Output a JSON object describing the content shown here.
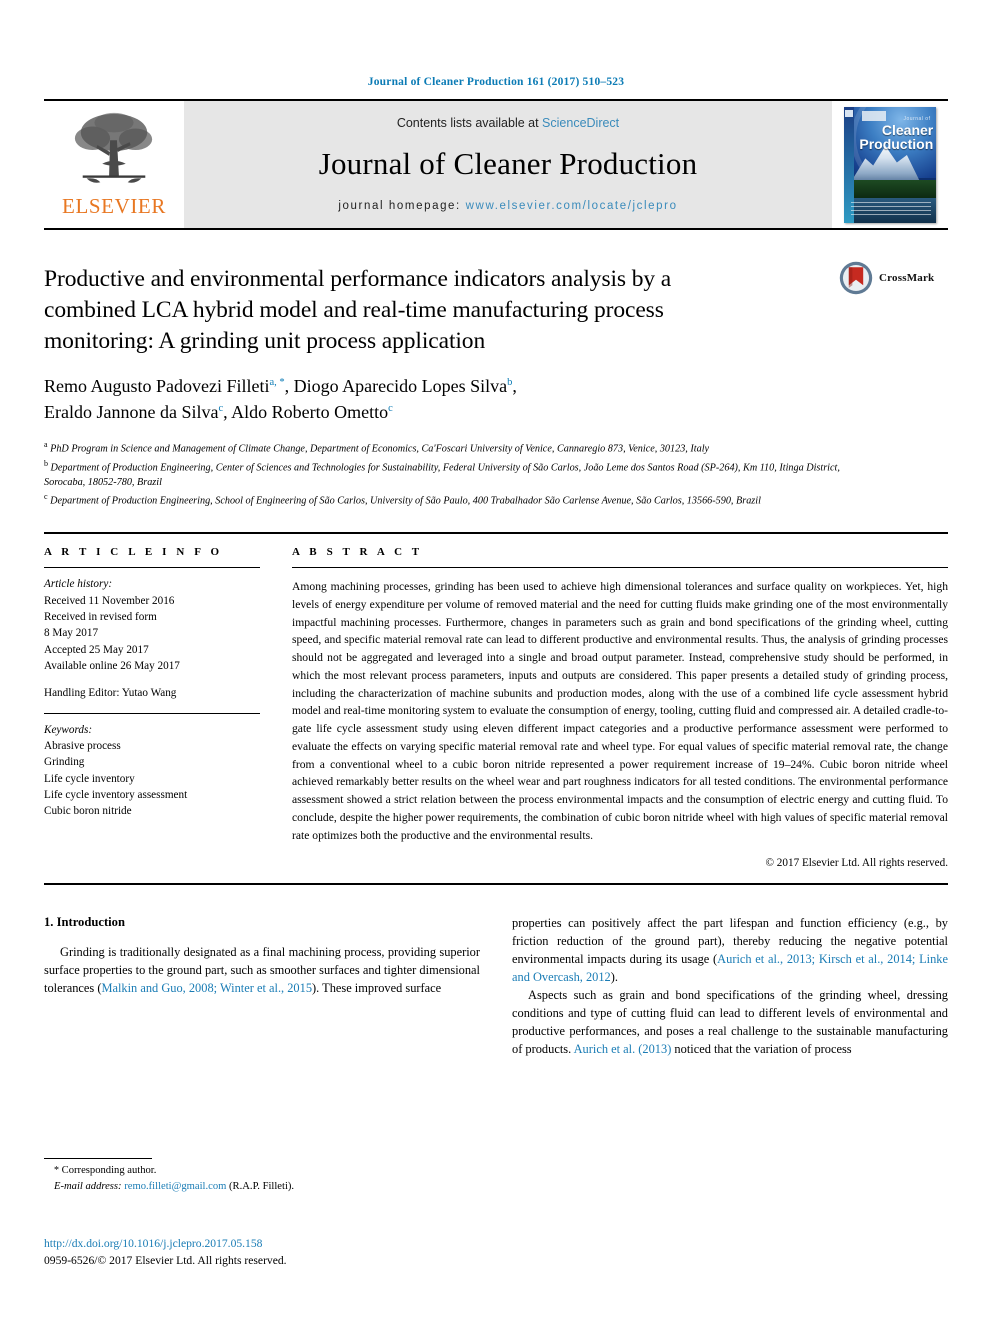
{
  "running_head": "Journal of Cleaner Production 161 (2017) 510–523",
  "masthead": {
    "publisher_name": "ELSEVIER",
    "contents_prefix": "Contents lists available at ",
    "contents_link": "ScienceDirect",
    "journal_name": "Journal of Cleaner Production",
    "homepage_prefix": "journal homepage: ",
    "homepage_url": "www.elsevier.com/locate/jclepro",
    "cover": {
      "small_title": "Journal of",
      "big_title_line1": "Cleaner",
      "big_title_line2": "Production"
    }
  },
  "crossmark": {
    "label": "CrossMark"
  },
  "article": {
    "title": "Productive and environmental performance indicators analysis by a combined LCA hybrid model and real-time manufacturing process monitoring: A grinding unit process application",
    "authors_line1_name1": "Remo Augusto Padovezi Filleti",
    "authors_line1_sup1": "a, *",
    "authors_line1_sep1": ", ",
    "authors_line1_name2": "Diogo Aparecido Lopes Silva",
    "authors_line1_sup2": "b",
    "authors_line1_end": ",",
    "authors_line2_name1": "Eraldo Jannone da Silva",
    "authors_line2_sup1": "c",
    "authors_line2_sep": ", ",
    "authors_line2_name2": "Aldo Roberto Ometto",
    "authors_line2_sup2": "c",
    "affiliations": [
      {
        "marker": "a",
        "text": "PhD Program in Science and Management of Climate Change, Department of Economics, Ca'Foscari University of Venice, Cannaregio 873, Venice, 30123, Italy"
      },
      {
        "marker": "b",
        "text": "Department of Production Engineering, Center of Sciences and Technologies for Sustainability, Federal University of São Carlos, João Leme dos Santos Road (SP-264), Km 110, Itinga District, Sorocaba, 18052-780, Brazil"
      },
      {
        "marker": "c",
        "text": "Department of Production Engineering, School of Engineering of São Carlos, University of São Paulo, 400 Trabalhador São Carlense Avenue, São Carlos, 13566-590, Brazil"
      }
    ]
  },
  "article_info": {
    "heading": "A R T I C L E   I N F O",
    "history_label": "Article history:",
    "received": "Received 11 November 2016",
    "revised_label": "Received in revised form",
    "revised_date": "8 May 2017",
    "accepted": "Accepted 25 May 2017",
    "available": "Available online 26 May 2017",
    "handling_editor": "Handling Editor: Yutao Wang",
    "keywords_label": "Keywords:",
    "keywords": [
      "Abrasive process",
      "Grinding",
      "Life cycle inventory",
      "Life cycle inventory assessment",
      "Cubic boron nitride"
    ]
  },
  "abstract": {
    "heading": "A B S T R A C T",
    "text": "Among machining processes, grinding has been used to achieve high dimensional tolerances and surface quality on workpieces. Yet, high levels of energy expenditure per volume of removed material and the need for cutting fluids make grinding one of the most environmentally impactful machining processes. Furthermore, changes in parameters such as grain and bond specifications of the grinding wheel, cutting speed, and specific material removal rate can lead to different productive and environmental results. Thus, the analysis of grinding processes should not be aggregated and leveraged into a single and broad output parameter. Instead, comprehensive study should be performed, in which the most relevant process parameters, inputs and outputs are considered. This paper presents a detailed study of grinding process, including the characterization of machine subunits and production modes, along with the use of a combined life cycle assessment hybrid model and real-time monitoring system to evaluate the consumption of energy, tooling, cutting fluid and compressed air. A detailed cradle-to-gate life cycle assessment study using eleven different impact categories and a productive performance assessment were performed to evaluate the effects on varying specific material removal rate and wheel type. For equal values of specific material removal rate, the change from a conventional wheel to a cubic boron nitride represented a power requirement increase of 19–24%. Cubic boron nitride wheel achieved remarkably better results on the wheel wear and part roughness indicators for all tested conditions. The environmental performance assessment showed a strict relation between the process environmental impacts and the consumption of electric energy and cutting fluid. To conclude, despite the higher power requirements, the combination of cubic boron nitride wheel with high values of specific material removal rate optimizes both the productive and the environmental results.",
    "copyright": "© 2017 Elsevier Ltd. All rights reserved."
  },
  "introduction": {
    "heading": "1. Introduction",
    "left_p1_a": "Grinding is traditionally designated as a final machining process, providing superior surface properties to the ground part, such as smoother surfaces and tighter dimensional tolerances (",
    "left_p1_cite": "Malkin and Guo, 2008; Winter et al., 2015",
    "left_p1_b": "). These improved surface",
    "right_p1_a": "properties can positively affect the part lifespan and function efficiency (e.g., by friction reduction of the ground part), thereby reducing the negative potential environmental impacts during its usage (",
    "right_p1_cite": "Aurich et al., 2013; Kirsch et al., 2014; Linke and Overcash, 2012",
    "right_p1_b": ").",
    "right_p2_a": "Aspects such as grain and bond specifications of the grinding wheel, dressing conditions and type of cutting fluid can lead to different levels of environmental and productive performances, and poses a real challenge to the sustainable manufacturing of products. ",
    "right_p2_cite": "Aurich et al. (2013)",
    "right_p2_b": " noticed that the variation of process"
  },
  "footnote": {
    "star": "*",
    "corresponding": "Corresponding author.",
    "email_label": "E-mail address:",
    "email": "remo.filleti@gmail.com",
    "email_attrib": "(R.A.P. Filleti).",
    "doi": "http://dx.doi.org/10.1016/j.jclepro.2017.05.158",
    "issn": "0959-6526/© 2017 Elsevier Ltd. All rights reserved."
  },
  "colors": {
    "link_blue": "#1a7cb5",
    "elsevier_orange": "#e87722",
    "banner_gray": "#e6e6e6"
  }
}
